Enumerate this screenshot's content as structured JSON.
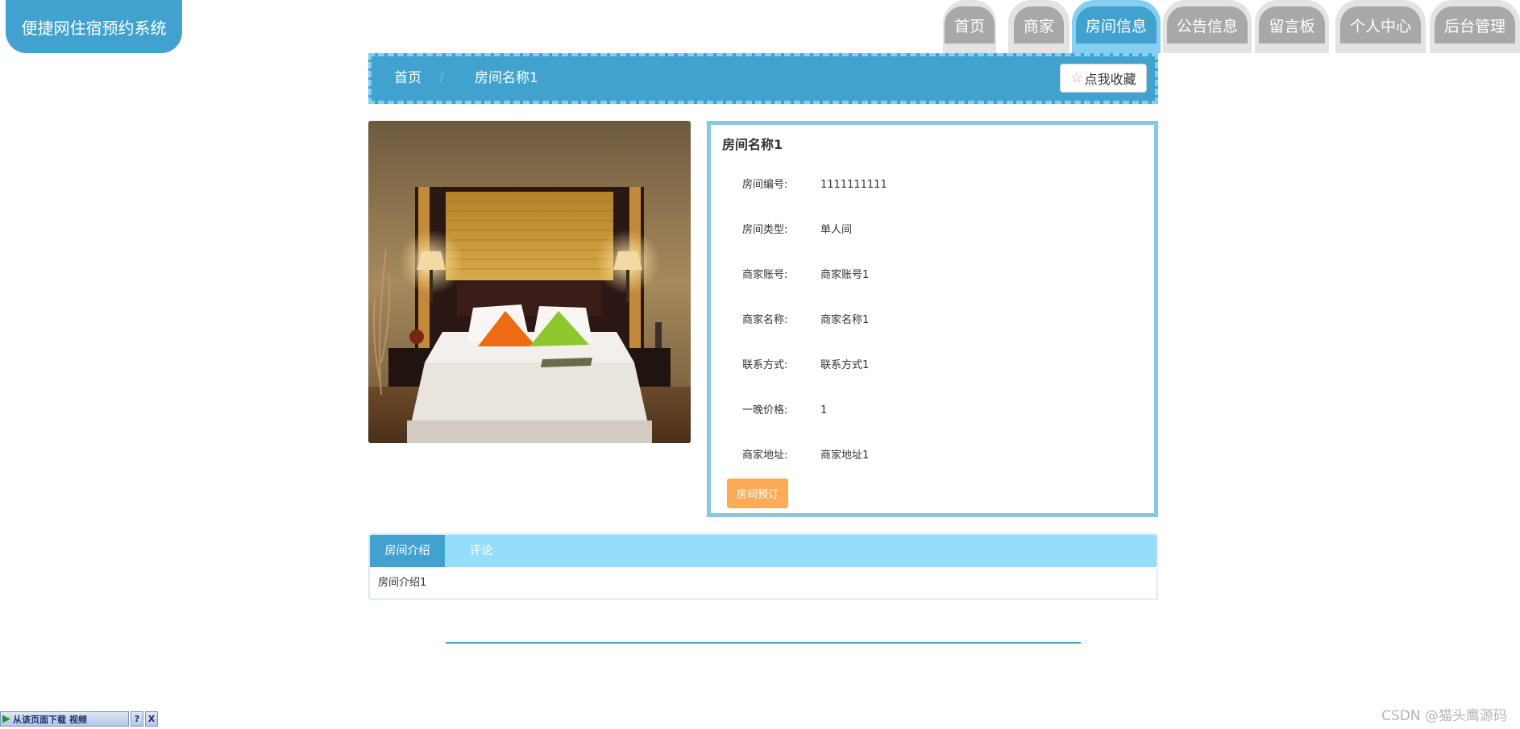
{
  "app": {
    "title": "便捷网住宿预约系统"
  },
  "nav": {
    "items": [
      {
        "label": "首页",
        "active": false
      },
      {
        "label": "商家",
        "active": false
      },
      {
        "label": "房间信息",
        "active": true
      },
      {
        "label": "公告信息",
        "active": false
      },
      {
        "label": "留言板",
        "active": false
      },
      {
        "label": "个人中心",
        "active": false
      },
      {
        "label": "后台管理",
        "active": false
      }
    ]
  },
  "breadcrumb": {
    "home": "首页",
    "separator": "/",
    "current": "房间名称1"
  },
  "favorite": {
    "label": "点我收藏",
    "icon": "star-outline-icon"
  },
  "room": {
    "image_alt": "bedroom-photo",
    "name": "房间名称1",
    "fields": [
      {
        "label": "房间编号:",
        "value": "1111111111"
      },
      {
        "label": "房间类型:",
        "value": "单人间"
      },
      {
        "label": "商家账号:",
        "value": "商家账号1"
      },
      {
        "label": "商家名称:",
        "value": "商家名称1"
      },
      {
        "label": "联系方式:",
        "value": "联系方式1"
      },
      {
        "label": "一晚价格:",
        "value": "1"
      },
      {
        "label": "商家地址:",
        "value": "商家地址1"
      }
    ],
    "book_label": "房间预订"
  },
  "tabs": {
    "items": [
      {
        "label": "房间介绍",
        "active": true
      },
      {
        "label": "评论",
        "active": false
      }
    ],
    "content": "房间介绍1"
  },
  "download_bar": {
    "label": "从该页面下载 视频",
    "help": "?",
    "close": "X"
  },
  "watermark": "CSDN @猫头鹰源码",
  "colors": {
    "primary": "#41a2cf",
    "light": "#86cff0",
    "tab_bar": "#96ddfc",
    "book_button": "#fdab56",
    "nav_inactive": "#a8a8a8"
  }
}
